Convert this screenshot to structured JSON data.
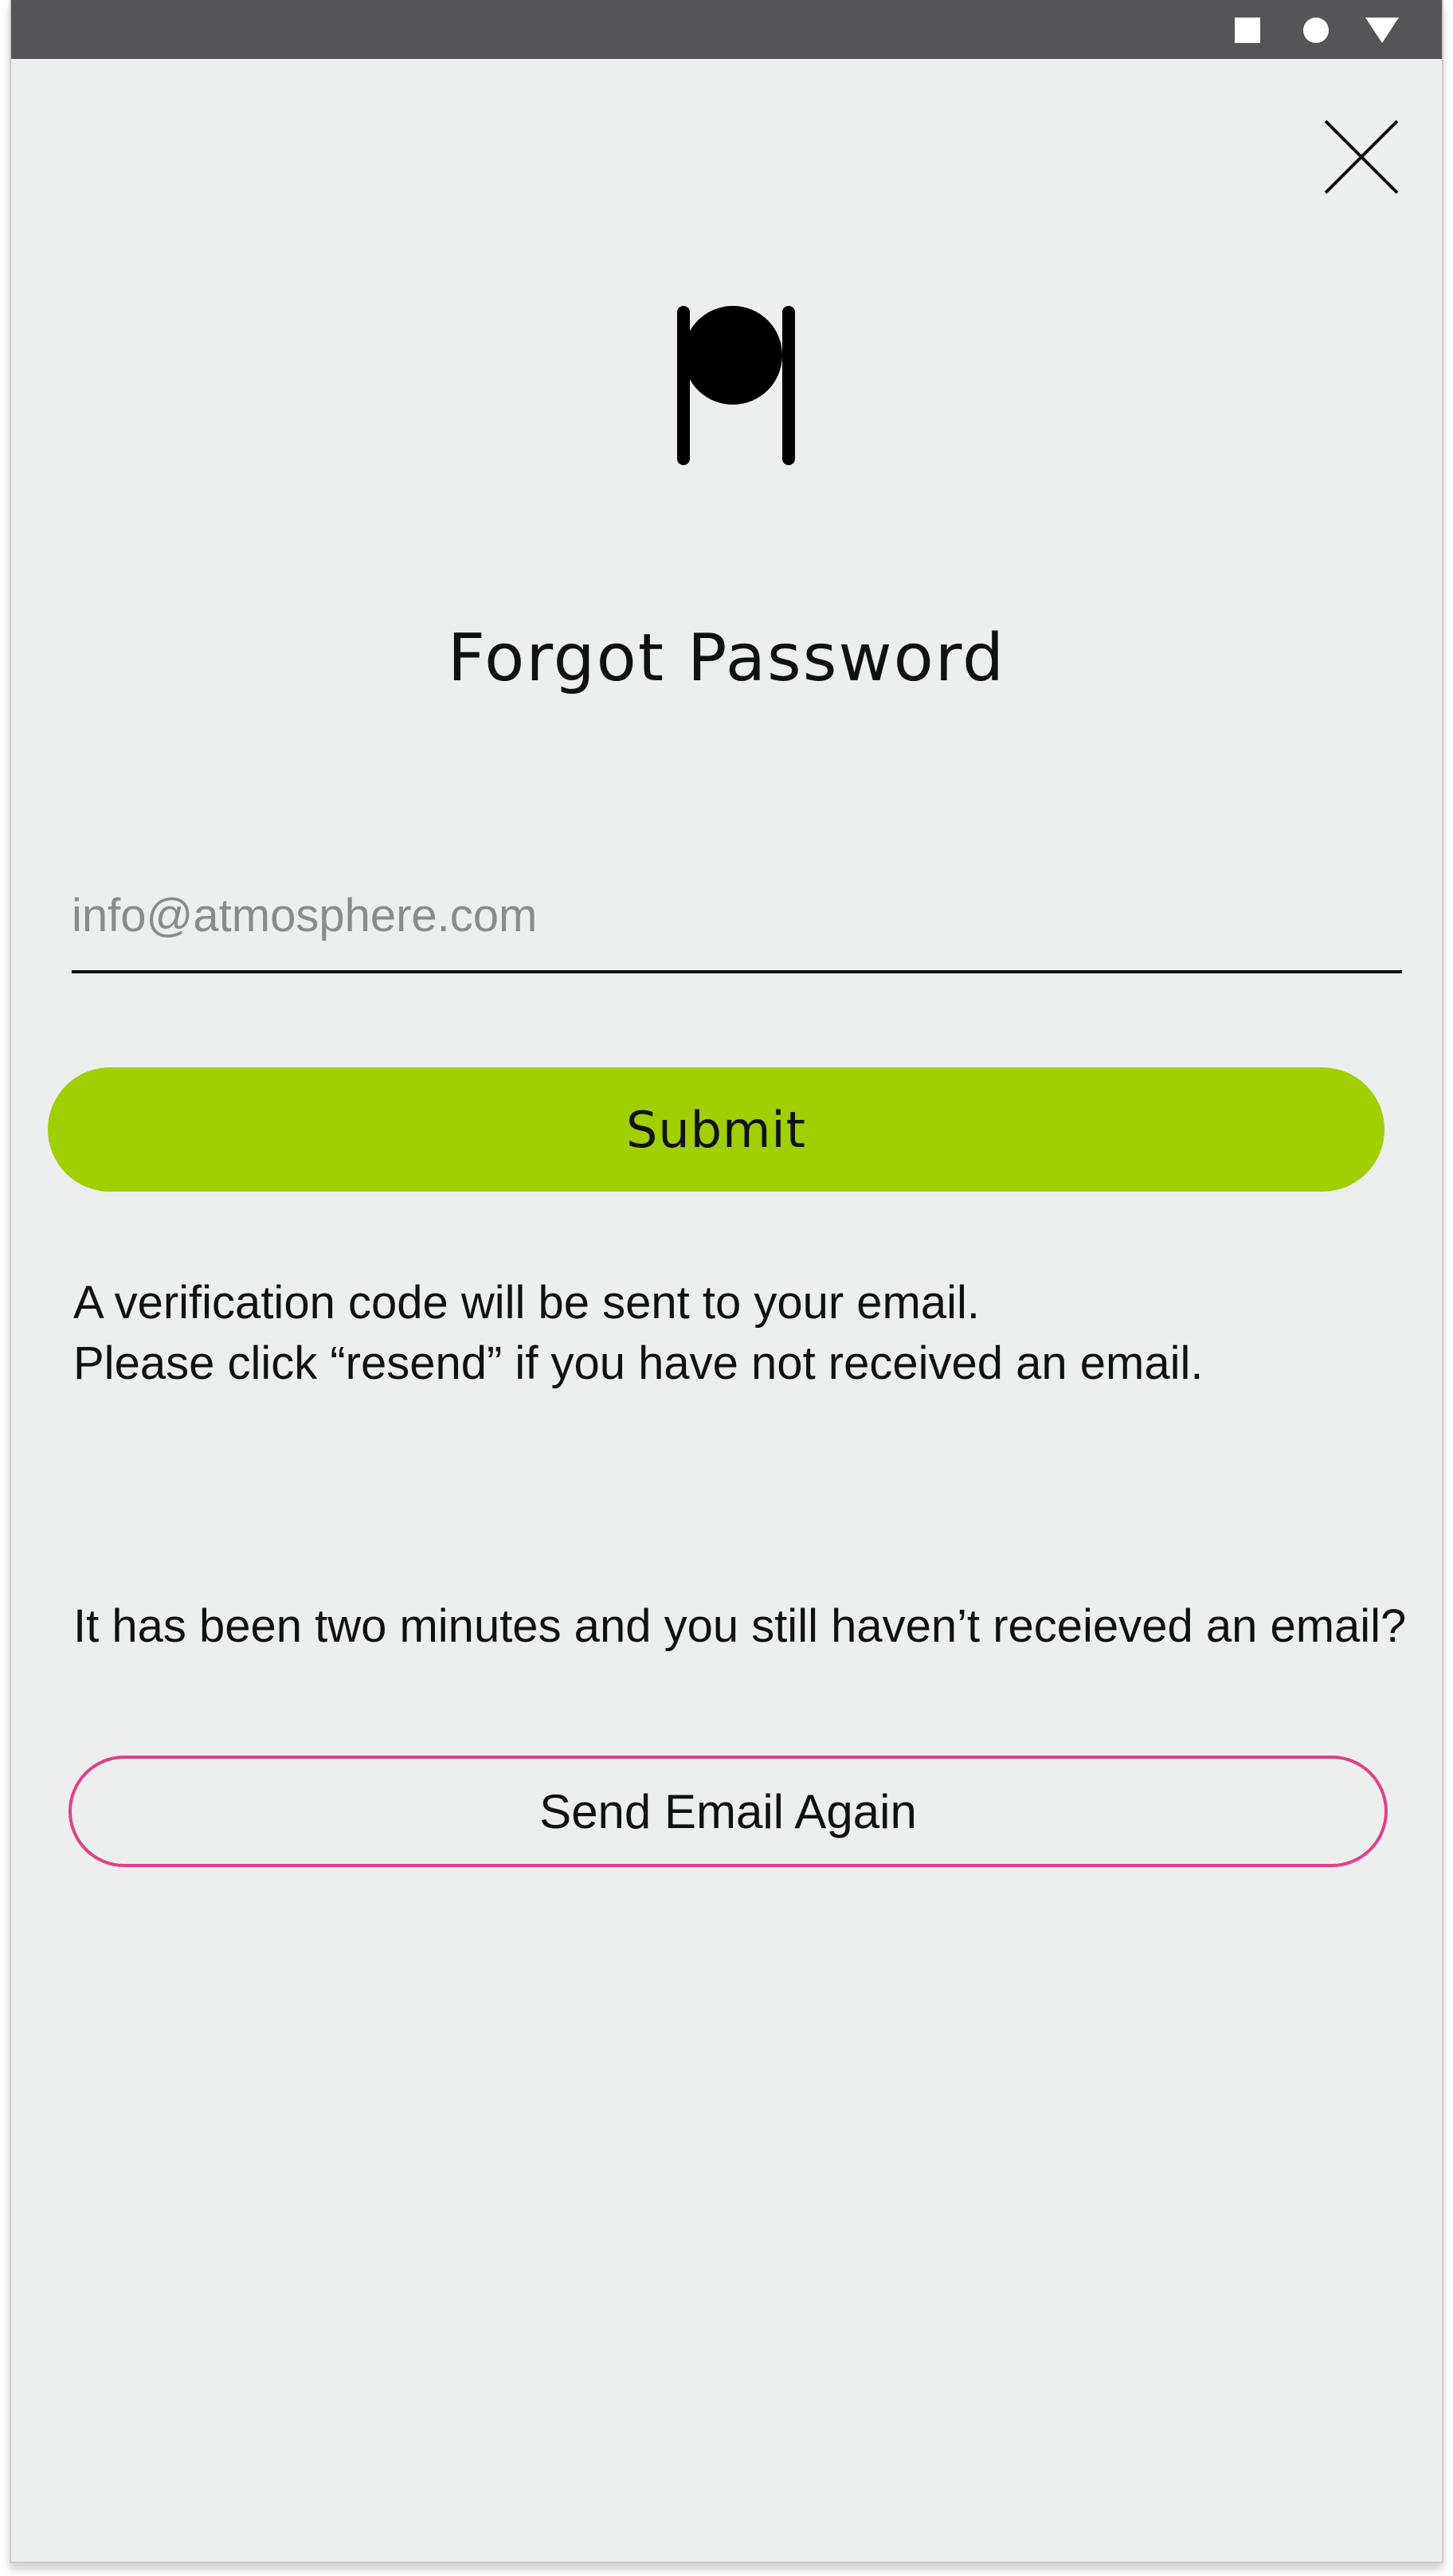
{
  "status_bar": {
    "icons": [
      "square-icon",
      "circle-icon",
      "triangle-icon"
    ],
    "background": "#555557"
  },
  "header": {
    "close_icon": "close-icon",
    "logo_icon": "plate-cutlery-logo-icon"
  },
  "main": {
    "title": "Forgot Password",
    "email_input": {
      "placeholder": "info@atmosphere.com",
      "value": ""
    },
    "submit_label": "Submit",
    "info_line_1": "A verification code will be sent to your email.",
    "info_line_2": "Please click “resend” if you have not received an email.",
    "resend_prompt": "It has been two minutes and you still haven’t receieved an email?",
    "resend_label": "Send Email Again"
  },
  "colors": {
    "background": "#edefef",
    "accent_green": "#a0cf03",
    "accent_pink": "#e0408a",
    "text": "#111111"
  }
}
